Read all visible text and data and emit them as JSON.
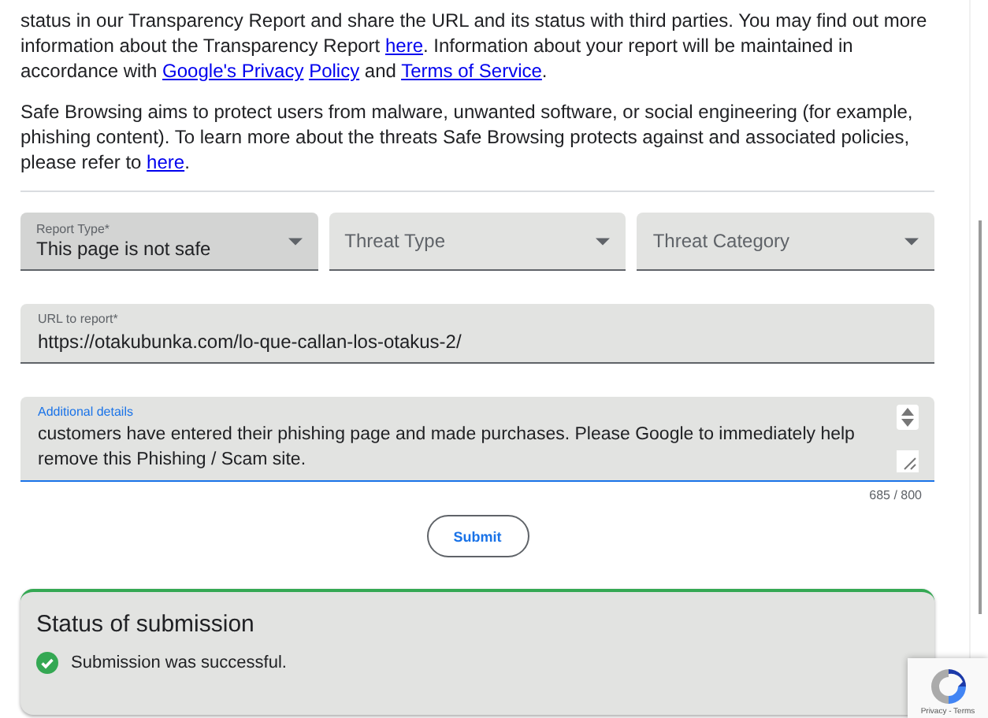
{
  "intro_paragraphs": [
    {
      "segments": [
        {
          "kind": "text",
          "text": "status in our Transparency Report and share the URL and its status with third parties. You may find out more information about the Transparency Report "
        },
        {
          "kind": "link",
          "text": "here"
        },
        {
          "kind": "text",
          "text": ". Information about your report will be maintained in accordance with "
        },
        {
          "kind": "link",
          "text": "Google's Privacy"
        },
        {
          "kind": "link",
          "text": "Policy"
        },
        {
          "kind": "text",
          "text": " and "
        },
        {
          "kind": "link",
          "text": "Terms of Service"
        },
        {
          "kind": "text",
          "text": "."
        }
      ]
    },
    {
      "segments": [
        {
          "kind": "text",
          "text": "Safe Browsing aims to protect users from malware, unwanted software, or social engineering (for example, phishing content). To learn more about the threats Safe Browsing protects against and associated policies, please refer to "
        },
        {
          "kind": "link",
          "text": "here"
        },
        {
          "kind": "text",
          "text": "."
        }
      ]
    }
  ],
  "dropdowns": [
    {
      "label": "Report Type*",
      "value": "This page is not safe",
      "selected": true
    },
    {
      "placeholder": "Threat Type",
      "selected": false
    },
    {
      "placeholder": "Threat Category",
      "selected": false
    }
  ],
  "url_field": {
    "label": "URL to report*",
    "value": "https://otakubunka.com/lo-que-callan-los-otakus-2/"
  },
  "details_field": {
    "label": "Additional details",
    "value": "customers have entered their phishing page and made purchases. Please Google to immediately help remove this Phishing / Scam site.",
    "focused": true,
    "counter": "685 / 800"
  },
  "submit_button": "Submit",
  "status": {
    "title": "Status of submission",
    "message": "Submission was successful.",
    "success": true
  },
  "recaptcha": {
    "links": "Privacy - Terms"
  }
}
